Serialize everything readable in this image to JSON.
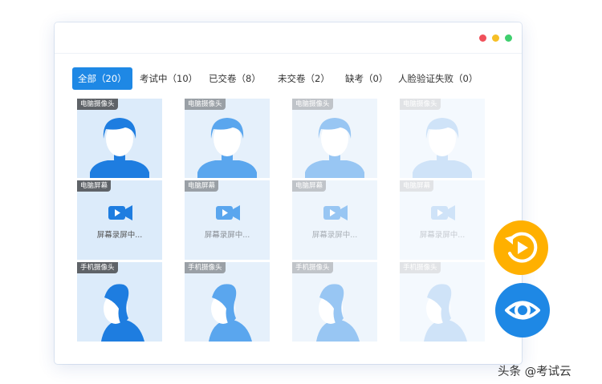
{
  "window": {
    "controls": [
      {
        "name": "close-dot",
        "color": "#f0505a"
      },
      {
        "name": "minimize-dot",
        "color": "#f6bf26"
      },
      {
        "name": "maximize-dot",
        "color": "#3fcf6e"
      }
    ]
  },
  "tabs": [
    {
      "label": "全部（20）",
      "active": true
    },
    {
      "label": "考试中（10）",
      "active": false
    },
    {
      "label": "已交卷（8）",
      "active": false
    },
    {
      "label": "未交卷（2）",
      "active": false
    },
    {
      "label": "缺考（0）",
      "active": false
    },
    {
      "label": "人脸验证失败（0）",
      "active": false
    }
  ],
  "rows": [
    {
      "kind": "pc-camera",
      "badge": "电脑摄像头",
      "icon": "front-avatar-icon"
    },
    {
      "kind": "screen",
      "badge": "电脑屏幕",
      "icon": "video-camera-icon",
      "status": "屏幕录屏中..."
    },
    {
      "kind": "phone-camera",
      "badge": "手机摄像头",
      "icon": "side-avatar-icon"
    }
  ],
  "columns": [
    {
      "figure": "#1e7de0",
      "bg": "#dcebfa",
      "badge_bg": "#5f6368",
      "text": "#555555"
    },
    {
      "figure": "#5aa6ee",
      "bg": "#e5f0fb",
      "badge_bg": "#9aa0a6",
      "text": "#8a8f96"
    },
    {
      "figure": "#98c6f3",
      "bg": "#eef5fc",
      "badge_bg": "#c0c4c9",
      "text": "#aab0b7"
    },
    {
      "figure": "#cfe3f8",
      "bg": "#f4f9fe",
      "badge_bg": "#e1e3e6",
      "text": "#c6cbd1"
    }
  ],
  "fab_replay": {
    "icon": "replay-icon",
    "color": "#ffb000"
  },
  "fab_view": {
    "icon": "eye-icon",
    "color": "#1e88e5"
  },
  "watermark": "头条 @考试云"
}
